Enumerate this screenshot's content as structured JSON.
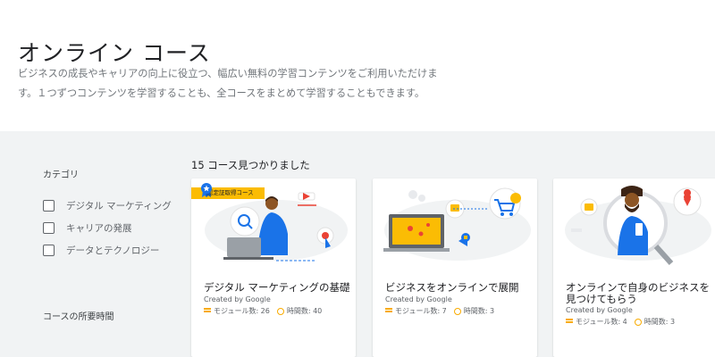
{
  "hero": {
    "title": "オンライン コース",
    "description": "ビジネスの成長やキャリアの向上に役立つ、幅広い無料の学習コンテンツをご利用いただけます。１つずつコンテンツを学習することも、全コースをまとめて学習することもできます。"
  },
  "sidebar": {
    "category_title": "カテゴリ",
    "filters": [
      {
        "label": "デジタル マーケティング",
        "checked": false
      },
      {
        "label": "キャリアの発展",
        "checked": false
      },
      {
        "label": "データとテクノロジー",
        "checked": false
      }
    ],
    "duration_title": "コースの所要時間"
  },
  "results": {
    "count_text": "15 コース見つかりました"
  },
  "courses": [
    {
      "badge": "認定証取得コース",
      "title": "デジタル マーケティングの基礎",
      "creator": "Created by Google",
      "modules": "モジュール数: 26",
      "hours": "時間数: 40"
    },
    {
      "title": "ビジネスをオンラインで展開",
      "creator": "Created by Google",
      "modules": "モジュール数: 7",
      "hours": "時間数: 3"
    },
    {
      "title": "オンラインで自身のビジネスを見つけてもらう",
      "creator": "Created by Google",
      "modules": "モジュール数: 4",
      "hours": "時間数: 3"
    }
  ],
  "colors": {
    "accent_yellow": "#fbbc04",
    "brand_blue": "#1a73e8",
    "background_gray": "#f1f3f4"
  }
}
